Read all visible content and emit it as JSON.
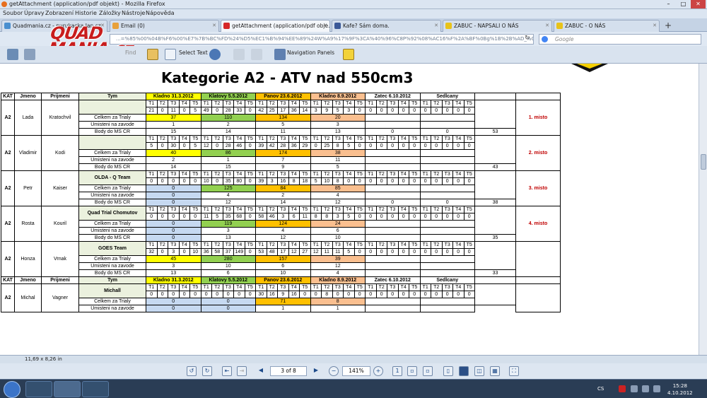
{
  "window": {
    "title": "getAttachment (application/pdf objekt) - Mozilla Firefox"
  },
  "menu": [
    "Soubor",
    "Úpravy",
    "Zobrazení",
    "Historie",
    "Záložky",
    "Nástroje",
    "Nápověda"
  ],
  "tabs": [
    {
      "label": "Quadmania.cz - purukacka Jan.cz",
      "active": false,
      "color": "#4a8fcf"
    },
    {
      "label": "Email (0)",
      "active": false,
      "color": "#e8a13a"
    },
    {
      "label": "getAttachment (application/pdf obje...",
      "active": true,
      "color": "#d62828"
    },
    {
      "label": "Kafe? Sám doma.",
      "active": false,
      "color": "#3b5998"
    },
    {
      "label": "ZABUC - NAPSALI O NÁS",
      "active": false,
      "color": "#e8c31a"
    },
    {
      "label": "ZABUC - O NÁS",
      "active": false,
      "color": "#e8c31a"
    }
  ],
  "url": "...=%85%00%04B%F6%00%E7%7B%BC%FD%24%D5%EC1%B%94%EE%89%24W%A9%17%9F%3CA%40%96%C8P%92%08%AC16%F%2A%BF%0Bg%1B%2B%AD_%CE%",
  "search_placeholder": "Google",
  "logo": {
    "line1": "QUAD",
    "line2": "MANIA.cz"
  },
  "pdf_toolbar": {
    "find": "Find",
    "select_text": "Select Text",
    "navigation_panels": "Navigation Panels"
  },
  "doc": {
    "title": "Kategorie A2 - ATV nad 550cm3",
    "headers": {
      "kat": "KAT",
      "jmeno": "Jmeno",
      "prijmeni": "Prijmeni",
      "tym": "Tym"
    },
    "races": [
      {
        "name": "Kladno 31.3.2012",
        "color": "yl"
      },
      {
        "name": "Klatovy 5.5.2012",
        "color": "gr"
      },
      {
        "name": "Panov 23.6.2012",
        "color": "or"
      },
      {
        "name": "Kladno 8.9.2012",
        "color": "sa"
      },
      {
        "name": "Zatec 6.10.2012",
        "color": ""
      },
      {
        "name": "Sedlcany",
        "color": ""
      }
    ],
    "trial_labels": [
      "T1",
      "T2",
      "T3",
      "T4",
      "T5"
    ],
    "row_labels": {
      "celkem": "Celkem za Trialy",
      "umisteni": "Umisteni na zavode",
      "body": "Body do MS CR"
    },
    "riders": [
      {
        "kat": "A2",
        "jmeno": "Lada",
        "prijmeni": "Kratochvil",
        "tym": "",
        "trials": [
          [
            21,
            0,
            11,
            0,
            5
          ],
          [
            49,
            0,
            28,
            33,
            0
          ],
          [
            42,
            25,
            17,
            36,
            14
          ],
          [
            3,
            9,
            5,
            3,
            0
          ],
          [
            0,
            0,
            0,
            0,
            0
          ],
          [
            0,
            0,
            0,
            0,
            0
          ]
        ],
        "celkem": [
          "37",
          "110",
          "134",
          "20",
          "",
          ""
        ],
        "umisteni": [
          "1",
          "2",
          "5",
          "3",
          "",
          ""
        ],
        "body": [
          "15",
          "14",
          "11",
          "13",
          "0",
          "0"
        ],
        "total": "53",
        "rank": "1. misto"
      },
      {
        "kat": "A2",
        "jmeno": "Vladimir",
        "prijmeni": "Kodi",
        "tym": "",
        "trials": [
          [
            5,
            0,
            30,
            0,
            5
          ],
          [
            12,
            0,
            28,
            46,
            0
          ],
          [
            39,
            42,
            28,
            36,
            29
          ],
          [
            0,
            25,
            8,
            5,
            0
          ],
          [
            0,
            0,
            0,
            0,
            0
          ],
          [
            0,
            0,
            0,
            0,
            0
          ]
        ],
        "celkem": [
          "40",
          "86",
          "174",
          "38",
          "",
          ""
        ],
        "umisteni": [
          "2",
          "1",
          "7",
          "11",
          "",
          ""
        ],
        "body": [
          "14",
          "15",
          "9",
          "5",
          "",
          ""
        ],
        "total": "43",
        "rank": "2. misto"
      },
      {
        "kat": "A2",
        "jmeno": "Petr",
        "prijmeni": "Kaiser",
        "tym": "OLDA - Q Team",
        "trials": [
          [
            0,
            0,
            0,
            0,
            0
          ],
          [
            10,
            0,
            35,
            80,
            0
          ],
          [
            39,
            3,
            16,
            8,
            18
          ],
          [
            5,
            10,
            8,
            0,
            0
          ],
          [
            0,
            0,
            0,
            0,
            0
          ],
          [
            0,
            0,
            0,
            0,
            0
          ]
        ],
        "celkem": [
          "0",
          "125",
          "84",
          "85",
          "",
          ""
        ],
        "umisteni": [
          "0",
          "4",
          "2",
          "4",
          "",
          ""
        ],
        "body": [
          "0",
          "12",
          "14",
          "12",
          "0",
          "0"
        ],
        "total": "38",
        "rank": "3. misto"
      },
      {
        "kat": "A2",
        "jmeno": "Rosta",
        "prijmeni": "Kouril",
        "tym": "Quad Trial Chomutov",
        "trials": [
          [
            0,
            0,
            0,
            0,
            0
          ],
          [
            11,
            5,
            35,
            68,
            0
          ],
          [
            58,
            46,
            3,
            6,
            11
          ],
          [
            8,
            8,
            3,
            5,
            0
          ],
          [
            0,
            0,
            0,
            0,
            0
          ],
          [
            0,
            0,
            0,
            0,
            0
          ]
        ],
        "celkem": [
          "0",
          "119",
          "124",
          "24",
          "",
          ""
        ],
        "umisteni": [
          "0",
          "3",
          "4",
          "6",
          "",
          ""
        ],
        "body": [
          "0",
          "13",
          "12",
          "10",
          "",
          ""
        ],
        "total": "35",
        "rank": "4. misto"
      },
      {
        "kat": "A2",
        "jmeno": "Honza",
        "prijmeni": "Vrnak",
        "tym": "GOES Team",
        "trials": [
          [
            32,
            0,
            3,
            0,
            10
          ],
          [
            36,
            58,
            37,
            149,
            0
          ],
          [
            53,
            48,
            17,
            12,
            27
          ],
          [
            12,
            11,
            11,
            5,
            0
          ],
          [
            0,
            0,
            0,
            0,
            0
          ],
          [
            0,
            0,
            0,
            0,
            0
          ]
        ],
        "celkem": [
          "45",
          "280",
          "157",
          "39",
          "",
          ""
        ],
        "umisteni": [
          "3",
          "10",
          "6",
          "12",
          "",
          ""
        ],
        "body": [
          "13",
          "6",
          "10",
          "4",
          "",
          ""
        ],
        "total": "33",
        "rank": ""
      },
      {
        "kat": "A2",
        "jmeno": "Michal",
        "prijmeni": "Vagner",
        "tym": "Michall",
        "trials": [
          [
            0,
            0,
            0,
            0,
            0
          ],
          [
            0,
            0,
            0,
            0,
            0
          ],
          [
            30,
            16,
            9,
            16,
            0
          ],
          [
            0,
            8,
            0,
            0,
            0
          ],
          [
            0,
            0,
            0,
            0,
            0
          ],
          [
            0,
            0,
            0,
            0,
            0
          ]
        ],
        "celkem": [
          "0",
          "0",
          "71",
          "8",
          "",
          ""
        ],
        "umisteni": [
          "0",
          "0",
          "1",
          "1",
          "",
          ""
        ],
        "body": null,
        "total": "",
        "rank": ""
      }
    ]
  },
  "status": {
    "page_size": "11,69 x 8,26 in"
  },
  "pdf_nav": {
    "page": "3 of 8",
    "zoom": "141%"
  },
  "tray": {
    "lang": "CS",
    "time": "15:28",
    "date": "4.10.2012"
  }
}
